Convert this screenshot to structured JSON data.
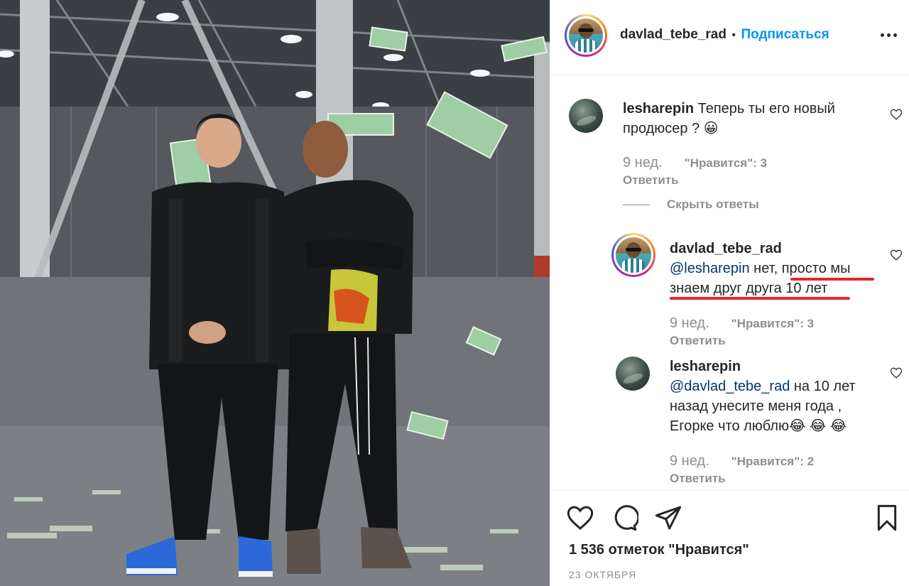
{
  "post": {
    "author": "davlad_tebe_rad",
    "separator": "•",
    "follow_label": "Подписаться",
    "more_icon": "more-options-icon"
  },
  "comments": [
    {
      "username": "lesharepin",
      "text": "Теперь ты его новый продюсер ? 😀",
      "text_line1": "Теперь ты его новый",
      "text_line2": "продюсер ? 😀",
      "age": "9 нед.",
      "likes": "\"Нравится\": 3",
      "reply_label": "Ответить",
      "hide_replies_label": "Скрыть ответы",
      "replies": [
        {
          "username": "davlad_tebe_rad",
          "mention": "@lesharepin",
          "text_a": " нет, ",
          "text_b": "просто мы",
          "text_line2": "знаем друг друга 10 лет",
          "age": "9 нед.",
          "likes": "\"Нравится\": 3",
          "reply_label": "Ответить"
        },
        {
          "username": "lesharepin",
          "mention": "@davlad_tebe_rad",
          "text_a": " на 10 лет",
          "text_line2": "назад унесите меня года ,",
          "text_line3": "Егорке что люблю😂 😂 😂",
          "age": "9 нед.",
          "likes": "\"Нравится\": 2",
          "reply_label": "Ответить"
        }
      ]
    }
  ],
  "footer": {
    "likes_count": "1 536 отметок \"Нравится\"",
    "date": "23 ОКТЯБРЯ"
  },
  "colors": {
    "link": "#0095f6",
    "mention": "#00376b",
    "muted": "#8e8e8e",
    "highlight_underline": "#e8262a"
  }
}
